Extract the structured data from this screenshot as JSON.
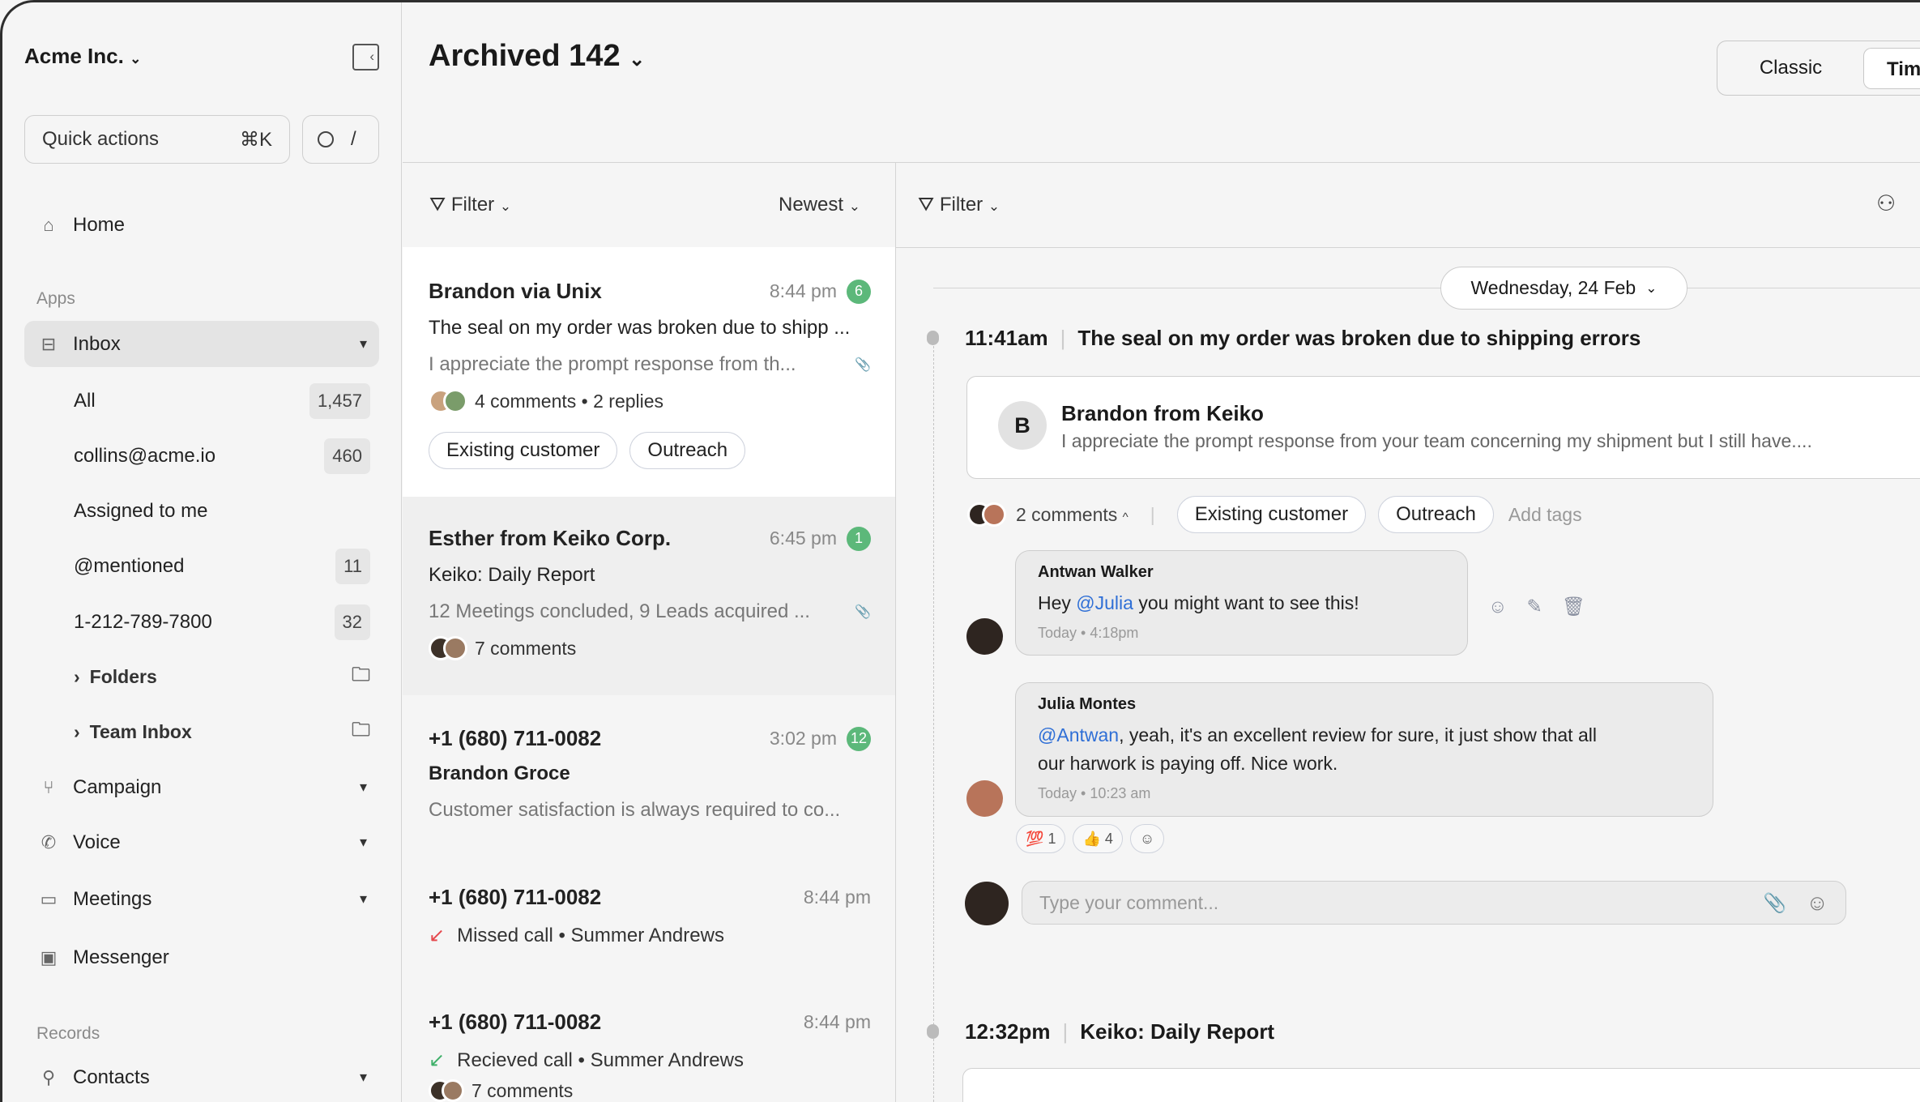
{
  "sidebar": {
    "workspace": "Acme Inc.",
    "quick_actions": "Quick actions",
    "quick_shortcut": "⌘K",
    "search_shortcut": "/",
    "home": "Home",
    "apps_label": "Apps",
    "inbox": "Inbox",
    "inbox_items": [
      {
        "label": "All",
        "count": "1,457"
      },
      {
        "label": "collins@acme.io",
        "count": "460"
      },
      {
        "label": "Assigned to me",
        "count": ""
      },
      {
        "label": "@mentioned",
        "count": "11"
      },
      {
        "label": "1-212-789-7800",
        "count": "32"
      }
    ],
    "folders": "Folders",
    "team_inbox": "Team Inbox",
    "campaign": "Campaign",
    "voice": "Voice",
    "meetings": "Meetings",
    "messenger": "Messenger",
    "records_label": "Records",
    "contacts": "Contacts"
  },
  "header": {
    "title": "Archived 142",
    "view_classic": "Classic",
    "view_timeline": "Tim"
  },
  "list": {
    "filter": "Filter",
    "sort": "Newest",
    "items": [
      {
        "name": "Brandon via Unix",
        "time": "8:44 pm",
        "badge": "6",
        "subject": "The seal on my order was broken due to shipp ...",
        "preview": "I appreciate the prompt response from th...",
        "meta": "4 comments • 2 replies",
        "tags": [
          "Existing customer",
          "Outreach"
        ]
      },
      {
        "name": "Esther from Keiko Corp.",
        "time": "6:45 pm",
        "badge": "1",
        "subject": "Keiko: Daily Report",
        "preview": "12 Meetings concluded, 9 Leads acquired ...",
        "meta": "7 comments"
      },
      {
        "name": "+1 (680) 711-0082",
        "time": "3:02 pm",
        "badge": "12",
        "subject": "Brandon Groce",
        "preview": "Customer satisfaction is always required to co..."
      },
      {
        "name": "+1 (680) 711-0082",
        "time": "8:44 pm",
        "call": "Missed call • Summer Andrews"
      },
      {
        "name": "+1 (680) 711-0082",
        "time": "8:44 pm",
        "call": "Recieved call • Summer Andrews",
        "meta": "7 comments"
      }
    ]
  },
  "timeline": {
    "filter": "Filter",
    "date": "Wednesday, 24 Feb",
    "event1": {
      "time": "11:41am",
      "title": "The seal on my order was broken due to shipping errors",
      "sender_initial": "B",
      "sender": "Brandon from Keiko",
      "preview": "I appreciate the prompt response from your team concerning my shipment but I still have....",
      "comments": "2 comments",
      "tags": [
        "Existing customer",
        "Outreach"
      ],
      "add_tags": "Add tags"
    },
    "comments": [
      {
        "author": "Antwan Walker",
        "pre": "Hey ",
        "mention": "@Julia",
        "post": " you might want to see this!",
        "time": "Today • 4:18pm"
      },
      {
        "author": "Julia Montes",
        "mention": "@Antwan",
        "post": ", yeah,  it's an excellent review for sure, it just show that all our harwork is paying off. Nice work.",
        "time": "Today • 10:23 am"
      }
    ],
    "reactions": [
      {
        "emoji": "💯",
        "count": "1"
      },
      {
        "emoji": "👍",
        "count": "4"
      }
    ],
    "comment_placeholder": "Type your comment...",
    "event2": {
      "time": "12:32pm",
      "title": "Keiko: Daily Report"
    }
  },
  "colors": {
    "badge": "#5cb87a",
    "mention": "#2f6fd6",
    "missed": "#e5484d",
    "received": "#3fb06a"
  }
}
